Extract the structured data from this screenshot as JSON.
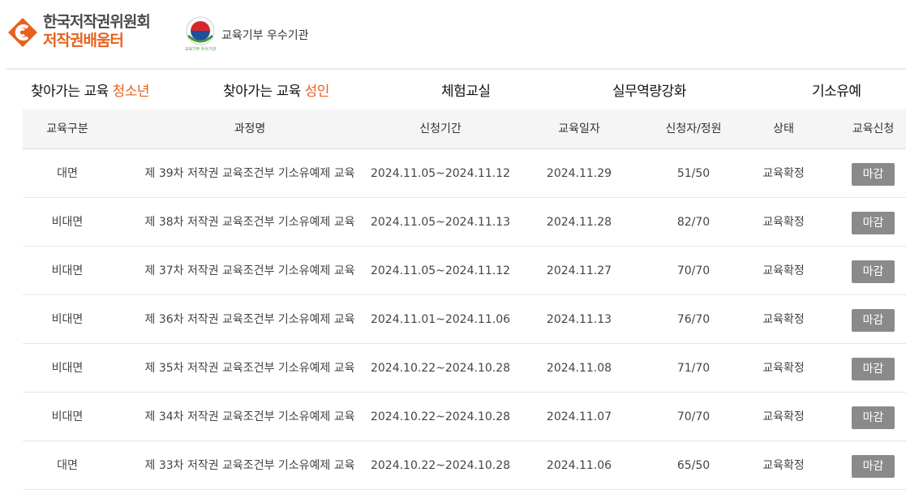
{
  "header": {
    "logo_line1": "한국저작권위원회",
    "logo_line2": "저작권배움터",
    "donation_badge_text": "교육기부 우수기관",
    "emblem_caption": "교육기부 우수기관"
  },
  "nav": [
    {
      "prefix": "찾아가는 교육 ",
      "highlight": "청소년"
    },
    {
      "prefix": "찾아가는 교육 ",
      "highlight": "성인"
    },
    {
      "prefix": "체험교실",
      "highlight": ""
    },
    {
      "prefix": "실무역량강화",
      "highlight": ""
    },
    {
      "prefix": "기소유예",
      "highlight": ""
    }
  ],
  "table": {
    "headers": [
      "교육구분",
      "과정명",
      "신청기간",
      "교육일자",
      "신청자/정원",
      "상태",
      "교육신청"
    ],
    "rows": [
      {
        "type": "대면",
        "course": "제 39차 저작권 교육조건부 기소유예제 교육",
        "period": "2024.11.05~2024.11.12",
        "date": "2024.11.29",
        "applicants": "51/50",
        "status": "교육확정",
        "action": "마감"
      },
      {
        "type": "비대면",
        "course": "제 38차 저작권 교육조건부 기소유예제 교육",
        "period": "2024.11.05~2024.11.13",
        "date": "2024.11.28",
        "applicants": "82/70",
        "status": "교육확정",
        "action": "마감"
      },
      {
        "type": "비대면",
        "course": "제 37차 저작권 교육조건부 기소유예제 교육",
        "period": "2024.11.05~2024.11.12",
        "date": "2024.11.27",
        "applicants": "70/70",
        "status": "교육확정",
        "action": "마감"
      },
      {
        "type": "비대면",
        "course": "제 36차 저작권 교육조건부 기소유예제 교육",
        "period": "2024.11.01~2024.11.06",
        "date": "2024.11.13",
        "applicants": "76/70",
        "status": "교육확정",
        "action": "마감"
      },
      {
        "type": "비대면",
        "course": "제 35차 저작권 교육조건부 기소유예제 교육",
        "period": "2024.10.22~2024.10.28",
        "date": "2024.11.08",
        "applicants": "71/70",
        "status": "교육확정",
        "action": "마감"
      },
      {
        "type": "비대면",
        "course": "제 34차 저작권 교육조건부 기소유예제 교육",
        "period": "2024.10.22~2024.10.28",
        "date": "2024.11.07",
        "applicants": "70/70",
        "status": "교육확정",
        "action": "마감"
      },
      {
        "type": "대면",
        "course": "제 33차 저작권 교육조건부 기소유예제 교육",
        "period": "2024.10.22~2024.10.28",
        "date": "2024.11.06",
        "applicants": "65/50",
        "status": "교육확정",
        "action": "마감"
      }
    ]
  },
  "colors": {
    "accent": "#e8601c",
    "button_gray": "#8a8a8a",
    "header_bg": "#f5f5f5"
  }
}
